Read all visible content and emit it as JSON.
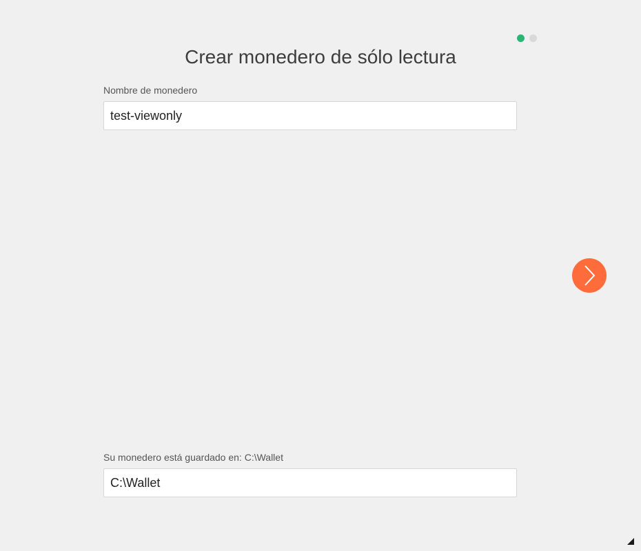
{
  "page": {
    "title": "Crear monedero de sólo lectura"
  },
  "progress": {
    "total_steps": 2,
    "current_step": 1,
    "active_color": "#2bb673",
    "inactive_color": "#d9d9d9"
  },
  "wallet_name": {
    "label": "Nombre de monedero",
    "value": "test-viewonly"
  },
  "wallet_location": {
    "label": "Su monedero está guardado en: C:\\Wallet",
    "value": "C:\\Wallet"
  },
  "next_button": {
    "icon": "chevron-right-icon",
    "color": "#ff6c3c"
  },
  "resize_grip": {
    "icon": "resize-grip-icon"
  }
}
